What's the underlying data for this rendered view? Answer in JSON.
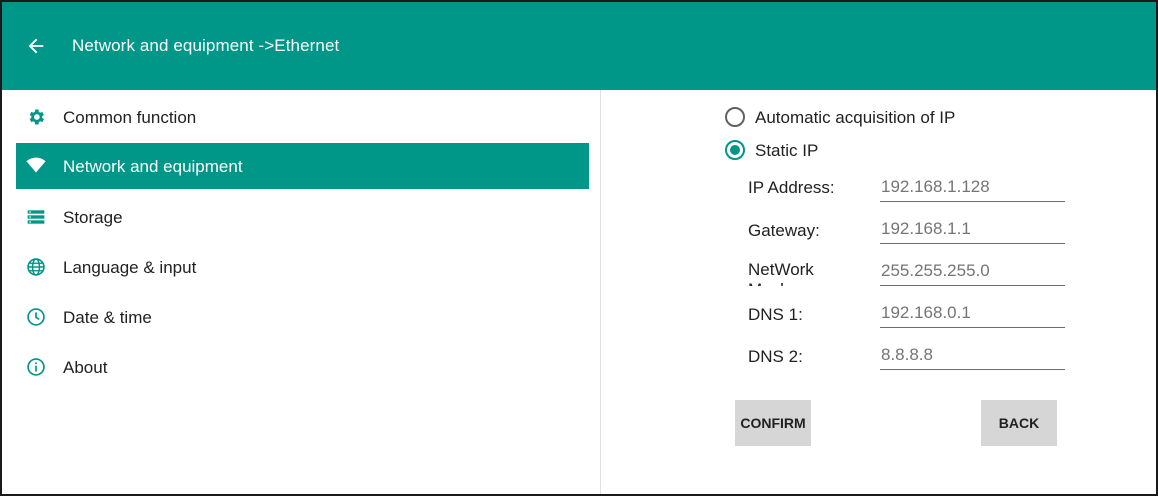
{
  "header": {
    "title": "Network and equipment ->Ethernet",
    "color": "#009688"
  },
  "sidebar": {
    "items": [
      {
        "label": "Common function",
        "icon": "gear-icon"
      },
      {
        "label": "Network and equipment",
        "icon": "wifi-icon",
        "active": true
      },
      {
        "label": "Storage",
        "icon": "storage-icon"
      },
      {
        "label": "Language & input",
        "icon": "globe-icon"
      },
      {
        "label": "Date & time",
        "icon": "clock-icon"
      },
      {
        "label": "About",
        "icon": "info-icon"
      }
    ]
  },
  "ip_mode": {
    "auto_label": "Automatic acquisition of IP",
    "static_label": "Static IP",
    "selected": "static"
  },
  "fields": {
    "ip": {
      "label": "IP Address:",
      "placeholder": "192.168.1.128"
    },
    "gateway": {
      "label": "Gateway:",
      "placeholder": "192.168.1.1"
    },
    "mask": {
      "label": "NetWork Mask:",
      "placeholder": "255.255.255.0"
    },
    "dns1": {
      "label": "DNS 1:",
      "placeholder": "192.168.0.1"
    },
    "dns2": {
      "label": "DNS 2:",
      "placeholder": "8.8.8.8"
    }
  },
  "buttons": {
    "confirm": "CONFIRM",
    "back": "BACK"
  }
}
